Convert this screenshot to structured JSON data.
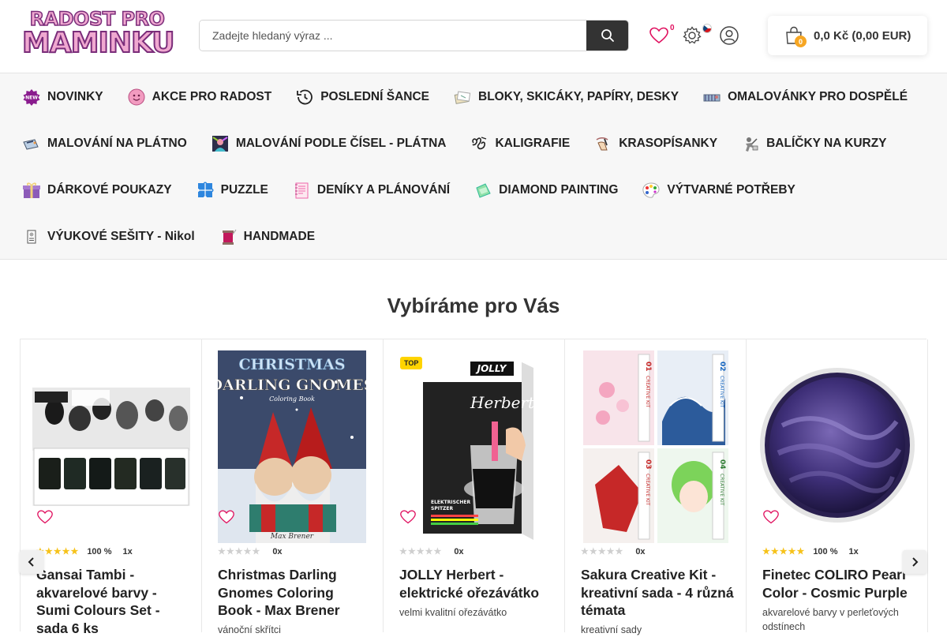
{
  "logo": {
    "line1": "RADOST PRO",
    "line2": "MAMINKU"
  },
  "search": {
    "placeholder": "Zadejte hledaný výraz ..."
  },
  "header": {
    "wishlist_count": "0",
    "cart_count": "0",
    "cart_total": "0,0 Kč (0,00 EUR)"
  },
  "nav": {
    "rows": [
      [
        {
          "label": "NOVINKY",
          "icon": "new-badge-icon"
        },
        {
          "label": "AKCE PRO RADOST",
          "icon": "smiley-ball-icon"
        },
        {
          "label": "POSLEDNÍ ŠANCE",
          "icon": "clock-history-icon"
        },
        {
          "label": "BLOKY, SKICÁKY, PAPÍRY, DESKY",
          "icon": "sketchbook-icon"
        },
        {
          "label": "OMALOVÁNKY PRO DOSPĚLÉ",
          "icon": "coloring-book-icon"
        }
      ],
      [
        {
          "label": "MALOVÁNÍ NA PLÁTNO",
          "icon": "canvas-icon"
        },
        {
          "label": "MALOVÁNÍ PODLE ČÍSEL - PLÁTNA",
          "icon": "paint-by-numbers-icon"
        },
        {
          "label": "KALIGRAFIE",
          "icon": "calligraphy-icon"
        },
        {
          "label": "KRASOPÍSANKY",
          "icon": "handwriting-icon"
        },
        {
          "label": "BALÍČKY NA KURZY",
          "icon": "course-package-icon"
        }
      ],
      [
        {
          "label": "DÁRKOVÉ POUKAZY",
          "icon": "gift-icon"
        },
        {
          "label": "PUZZLE",
          "icon": "puzzle-icon"
        },
        {
          "label": "DENÍKY A PLÁNOVÁNÍ",
          "icon": "planner-icon"
        },
        {
          "label": "DIAMOND PAINTING",
          "icon": "diamond-icon"
        },
        {
          "label": "VÝTVARNÉ POTŘEBY",
          "icon": "palette-icon"
        }
      ],
      [
        {
          "label": "VÝUKOVÉ SEŠITY - Nikol",
          "icon": "workbook-icon"
        },
        {
          "label": "HANDMADE",
          "icon": "thread-icon"
        }
      ]
    ]
  },
  "section_title": "Vybíráme pro Vás",
  "products": [
    {
      "title": "Gansai Tambi - akvarelové barvy - Sumi Colours Set - sada 6 ks",
      "rating_pct": "100 %",
      "count": "1x",
      "stars": 5,
      "desc": "",
      "top": ""
    },
    {
      "title": "Christmas Darling Gnomes Coloring Book - Max Brener",
      "rating_pct": "",
      "count": "0x",
      "stars": 0,
      "desc": "vánoční skřítci",
      "top": "",
      "cover_title1": "CHRISTMAS",
      "cover_title2": "DARLING GNOMES",
      "cover_sub": "Coloring Book",
      "cover_author": "Max Brener"
    },
    {
      "title": "JOLLY Herbert - elektrické ořezávátko",
      "rating_pct": "",
      "count": "0x",
      "stars": 0,
      "desc": "velmi kvalitní ořezávátko",
      "top": "TOP",
      "box_brand": "JOLLY",
      "box_name": "Herbert",
      "box_label1": "ELEKTRISCHER",
      "box_label2": "SPITZER"
    },
    {
      "title": "Sakura Creative Kit - kreativní sada - 4 různá témata",
      "rating_pct": "",
      "count": "0x",
      "stars": 0,
      "desc": "kreativní sady",
      "top": "",
      "kit_label": "CREATIVE KIT",
      "kit_nums": [
        "01",
        "02",
        "03",
        "04"
      ]
    },
    {
      "title": "Finetec COLIRO Pearl Color - Cosmic Purple",
      "rating_pct": "100 %",
      "count": "1x",
      "stars": 5,
      "desc": "akvarelové barvy v perleťových odstínech",
      "top": ""
    }
  ],
  "colors": {
    "accent": "#e0115f",
    "star": "#f6c21a",
    "cart_badge": "#f6a623",
    "top_badge": "#ffd400"
  }
}
